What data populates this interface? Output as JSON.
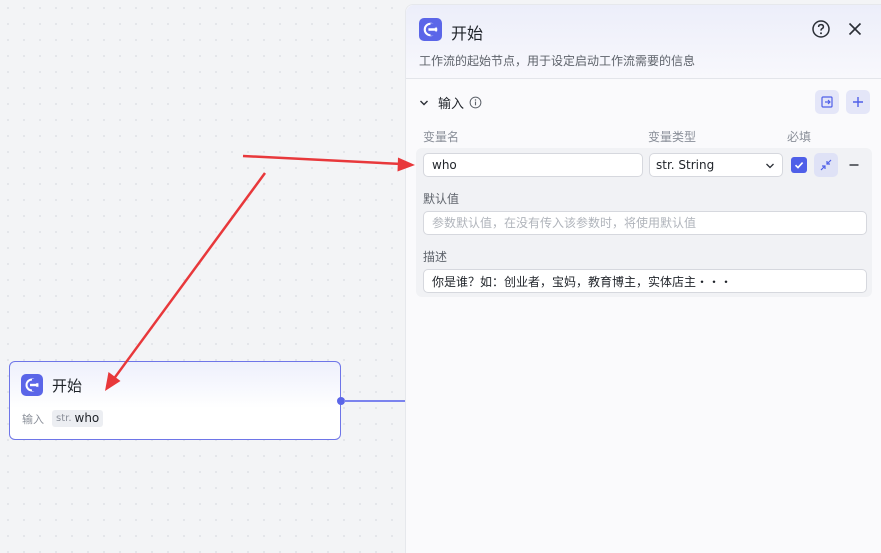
{
  "node": {
    "title": "开始",
    "input_label": "输入",
    "chip_type": "str.",
    "chip_name": "who"
  },
  "panel": {
    "title": "开始",
    "description": "工作流的起始节点，用于设定启动工作流需要的信息",
    "section_title": "输入",
    "columns": {
      "name": "变量名",
      "type": "变量类型",
      "required": "必填"
    },
    "variable": {
      "name": "who",
      "type": "str. String",
      "required": true
    },
    "default_label": "默认值",
    "default_placeholder": "参数默认值，在没有传入该参数时，将使用默认值",
    "desc_label": "描述",
    "desc_value": "你是谁？如：创业者，宝妈，教育博主，实体店主・・・"
  },
  "colors": {
    "accent": "#5b66e8",
    "arrow": "#e8383b"
  }
}
